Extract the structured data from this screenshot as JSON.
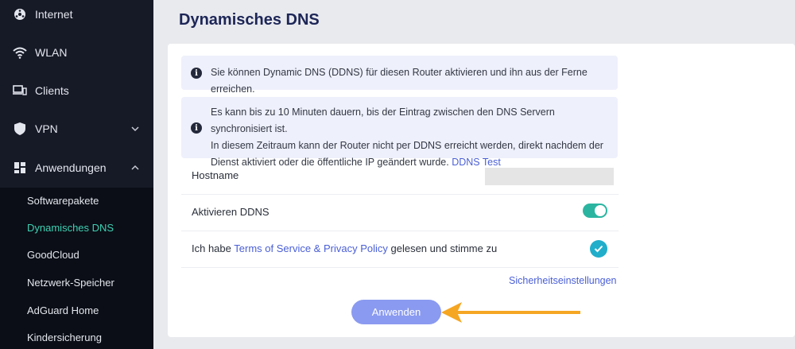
{
  "sidebar": {
    "items": [
      {
        "label": "Internet",
        "icon": "globe-icon"
      },
      {
        "label": "WLAN",
        "icon": "wifi-icon"
      },
      {
        "label": "Clients",
        "icon": "devices-icon"
      },
      {
        "label": "VPN",
        "icon": "shield-icon",
        "chevron": "down"
      },
      {
        "label": "Anwendungen",
        "icon": "apps-grid-icon",
        "chevron": "up"
      }
    ],
    "sub_items": [
      {
        "label": "Softwarepakete",
        "active": false
      },
      {
        "label": "Dynamisches DNS",
        "active": true
      },
      {
        "label": "GoodCloud",
        "active": false
      },
      {
        "label": "Netzwerk-Speicher",
        "active": false
      },
      {
        "label": "AdGuard Home",
        "active": false
      },
      {
        "label": "Kindersicherung",
        "active": false
      }
    ]
  },
  "main": {
    "title": "Dynamisches DNS",
    "info1": "Sie können Dynamic DNS (DDNS) für diesen Router aktivieren und ihn aus der Ferne erreichen.",
    "info2": {
      "line1": "Es kann bis zu 10 Minuten dauern, bis der Eintrag zwischen den DNS Servern synchronisiert ist.",
      "line2": "In diesem Zeitraum kann der Router nicht per DDNS erreicht werden, direkt nachdem der",
      "line3": "Dienst aktiviert oder die öffentliche IP geändert wurde.",
      "link": "DDNS Test"
    },
    "hostname_label": "Hostname",
    "hostname_value": "",
    "ddns_label": "Aktivieren DDNS",
    "ddns_enabled": true,
    "terms": {
      "prefix": "Ich habe",
      "link": "Terms of Service & Privacy Policy",
      "suffix": "gelesen und stimme zu",
      "checked": true
    },
    "security_link": "Sicherheitseinstellungen",
    "apply_label": "Anwenden"
  },
  "colors": {
    "sidebar_bg": "#161a26",
    "accent_active": "#3ed1b4",
    "toggle_on": "#2bb5a1",
    "check": "#20aecb",
    "apply_button": "#8a9af0",
    "link": "#4a5fd6",
    "arrow": "#f5a623"
  }
}
